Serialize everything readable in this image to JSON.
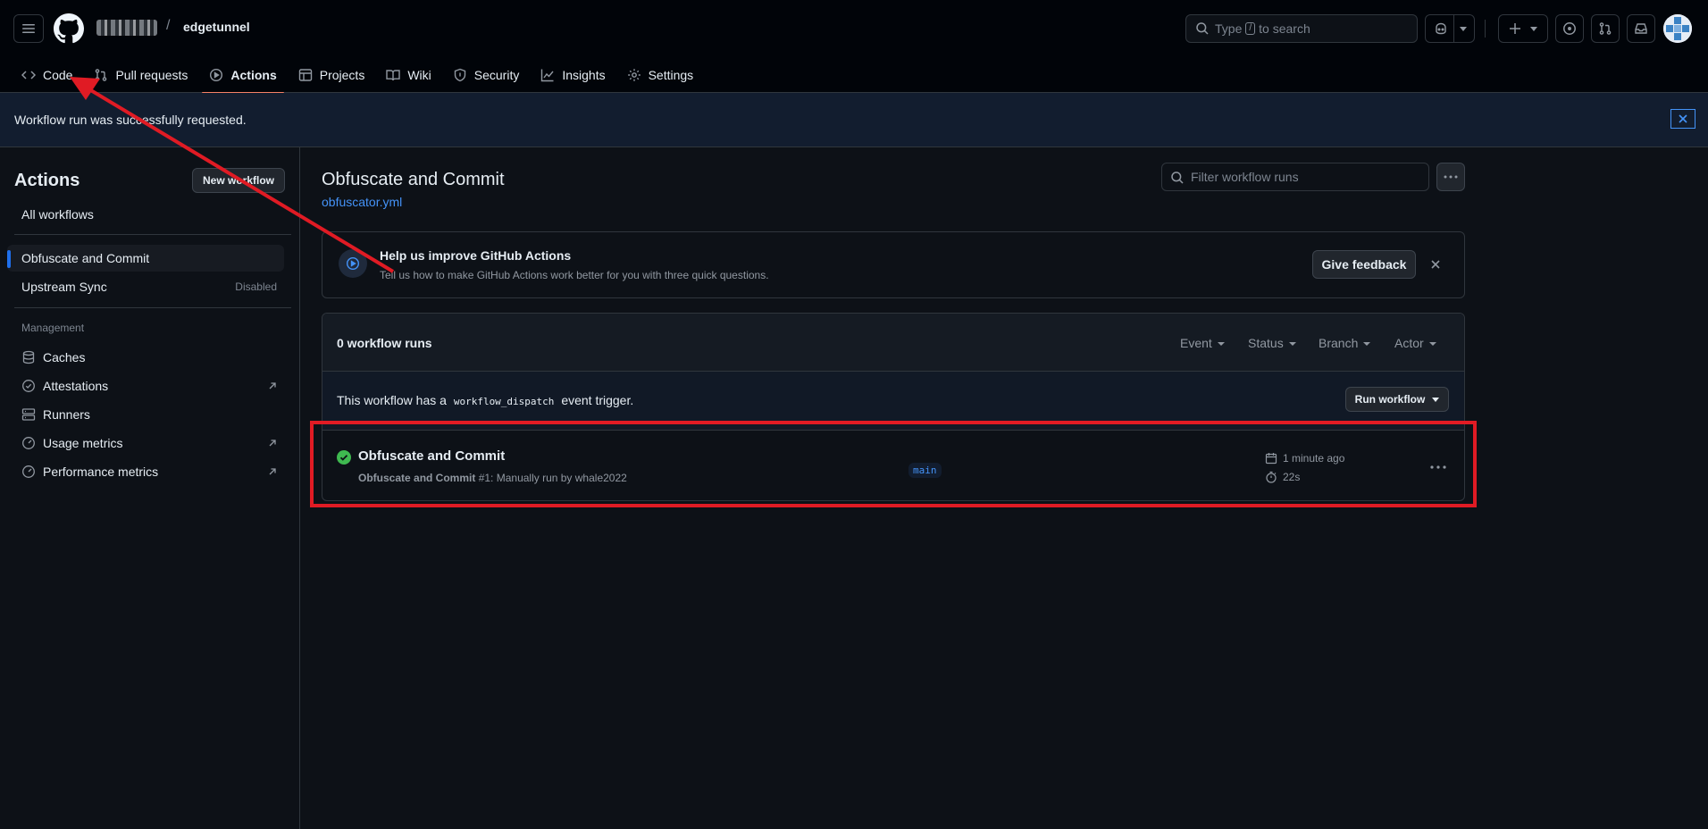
{
  "header": {
    "owner": "",
    "separator": "/",
    "repo": "edgetunnel",
    "search_prefix": "Type",
    "search_key": "/",
    "search_suffix": "to search"
  },
  "tabs": [
    {
      "label": "Code",
      "icon": "code-icon"
    },
    {
      "label": "Pull requests",
      "icon": "pull-request-icon"
    },
    {
      "label": "Actions",
      "icon": "play-icon"
    },
    {
      "label": "Projects",
      "icon": "table-icon"
    },
    {
      "label": "Wiki",
      "icon": "book-icon"
    },
    {
      "label": "Security",
      "icon": "shield-icon"
    },
    {
      "label": "Insights",
      "icon": "graph-icon"
    },
    {
      "label": "Settings",
      "icon": "gear-icon"
    }
  ],
  "flash": {
    "message": "Workflow run was successfully requested."
  },
  "sidebar": {
    "title": "Actions",
    "new_workflow": "New workflow",
    "all_workflows": "All workflows",
    "workflows": [
      {
        "label": "Obfuscate and Commit",
        "badge": ""
      },
      {
        "label": "Upstream Sync",
        "badge": "Disabled"
      }
    ],
    "management_heading": "Management",
    "management": [
      {
        "label": "Caches",
        "icon": "database-icon"
      },
      {
        "label": "Attestations",
        "icon": "verified-icon"
      },
      {
        "label": "Runners",
        "icon": "server-icon"
      },
      {
        "label": "Usage metrics",
        "icon": "meter-icon"
      },
      {
        "label": "Performance metrics",
        "icon": "meter-icon"
      }
    ]
  },
  "main": {
    "title": "Obfuscate and Commit",
    "file_link": "obfuscator.yml",
    "filter_placeholder": "Filter workflow runs",
    "feedback": {
      "title": "Help us improve GitHub Actions",
      "subtitle": "Tell us how to make GitHub Actions work better for you with three quick questions.",
      "button": "Give feedback"
    },
    "runs": {
      "count": "0 workflow runs",
      "filters": [
        "Event",
        "Status",
        "Branch",
        "Actor"
      ],
      "dispatch_prefix": "This workflow has a",
      "dispatch_code": "workflow_dispatch",
      "dispatch_suffix": "event trigger.",
      "run_workflow": "Run workflow"
    },
    "run": {
      "title": "Obfuscate and Commit",
      "sub_bold": "Obfuscate and Commit",
      "sub_rest": "#1: Manually run by whale2022",
      "branch": "main",
      "time": "1 minute ago",
      "duration": "22s",
      "status": "success"
    }
  },
  "colors": {
    "accent": "#1f6feb",
    "link": "#4493f8",
    "success": "#3fb950",
    "annotation": "#e01b24",
    "active_tab_underline": "#f78166"
  }
}
